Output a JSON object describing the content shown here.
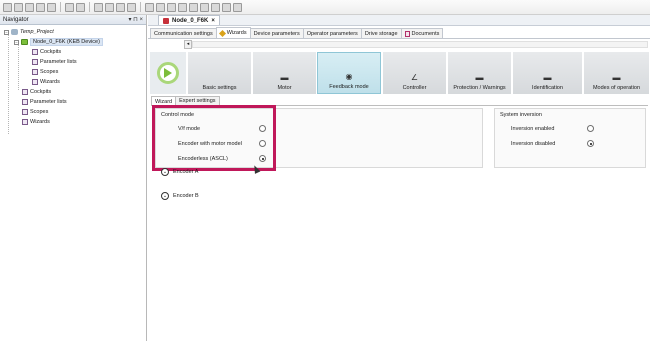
{
  "navigator": {
    "title": "Navigator",
    "pin_symbol": "▾ ⊓ ×",
    "project": "Temp_Project",
    "device": "Node_0_F6K (KEB Device)",
    "device_children": [
      "Cockpits",
      "Parameter lists",
      "Scopes",
      "Wizards"
    ],
    "root_children": [
      "Cockpits",
      "Parameter lists",
      "Scopes",
      "Wizards"
    ]
  },
  "document_tab": {
    "label": "Node_0_F6K",
    "close": "×"
  },
  "sub_tabs": [
    {
      "label": "Communication settings",
      "active": false
    },
    {
      "label": "Wizards",
      "active": true
    },
    {
      "label": "Device parameters",
      "active": false
    },
    {
      "label": "Operator parameters",
      "active": false
    },
    {
      "label": "Drive storage",
      "active": false
    },
    {
      "label": "Documents",
      "active": false
    }
  ],
  "wizard_steps": [
    {
      "label": "Basic settings",
      "icon": ""
    },
    {
      "label": "Motor",
      "icon": "▬"
    },
    {
      "label": "Feedback mode",
      "icon": "◉"
    },
    {
      "label": "Controller",
      "icon": "∠"
    },
    {
      "label": "Protection / Warnings",
      "icon": "▬"
    },
    {
      "label": "Identification",
      "icon": "▬"
    },
    {
      "label": "Modes of operation",
      "icon": "▬"
    }
  ],
  "active_step": "Feedback mode",
  "inner_tabs": [
    {
      "label": "Wizard",
      "active": true
    },
    {
      "label": "Expert settings",
      "active": false
    }
  ],
  "control_mode": {
    "title": "Control mode",
    "options": [
      {
        "label": "V/f mode",
        "checked": false
      },
      {
        "label": "Encoder with motor model",
        "checked": false
      },
      {
        "label": "Encoderless (ASCL)",
        "checked": true
      }
    ]
  },
  "system_inversion": {
    "title": "System inversion",
    "options": [
      {
        "label": "Inversion enabled",
        "checked": false
      },
      {
        "label": "Inversion disabled",
        "checked": true
      }
    ]
  },
  "encoders": [
    {
      "label": "Encoder A",
      "symbol": "⌄"
    },
    {
      "label": "Encoder B",
      "symbol": "⌄"
    }
  ],
  "colors": {
    "highlight": "#c0185a",
    "active_step": "#bfe0ea",
    "start_green": "#7cbd3a"
  }
}
